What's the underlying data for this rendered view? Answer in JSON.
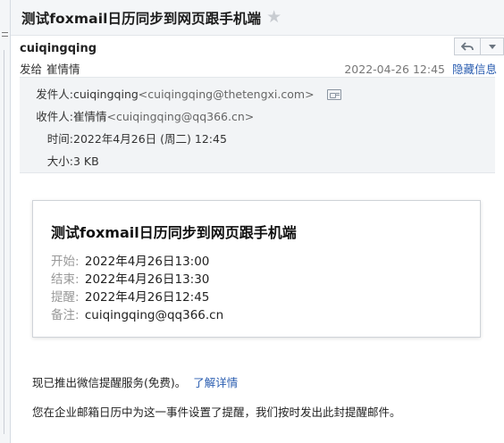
{
  "subject": "测试foxmail日历同步到网页跟手机端",
  "sender": {
    "name": "cuiqingqing",
    "sendto_label": "发给",
    "recipient": "崔情情",
    "date": "2022-04-26 12:45",
    "hide_details_label": "隐藏信息"
  },
  "details": {
    "from_label": "发件人:",
    "from_name": "cuiqingqing",
    "from_addr": "<cuiqingqing@thetengxi.com>",
    "to_label": "收件人:",
    "to_name": "崔情情",
    "to_addr": "<cuiqingqing@qq366.cn>",
    "time_label": "时间:",
    "time_value": "2022年4月26日 (周二) 12:45",
    "size_label": "大小:",
    "size_value": "3 KB"
  },
  "card": {
    "title": "测试foxmail日历同步到网页跟手机端",
    "rows": [
      {
        "label": "开始:",
        "value": "2022年4月26日13:00"
      },
      {
        "label": "结束:",
        "value": "2022年4月26日13:30"
      },
      {
        "label": "提醒:",
        "value": "2022年4月26日12:45"
      },
      {
        "label": "备注:",
        "value": "cuiqingqing@qq366.cn"
      }
    ]
  },
  "notice": {
    "text": "现已推出微信提醒服务(免费)。",
    "link": "了解详情"
  },
  "footer_text": "您在企业邮箱日历中为这一事件设置了提醒，我们按时发出此封提醒邮件。",
  "icons": {
    "star": "star-icon",
    "reply": "reply-icon",
    "more": "chevron-down-icon",
    "contact_card": "contact-card-icon"
  },
  "colors": {
    "link": "#2a5db0",
    "star": "#c8ccd1",
    "detail_bg": "#f2f4f6"
  }
}
